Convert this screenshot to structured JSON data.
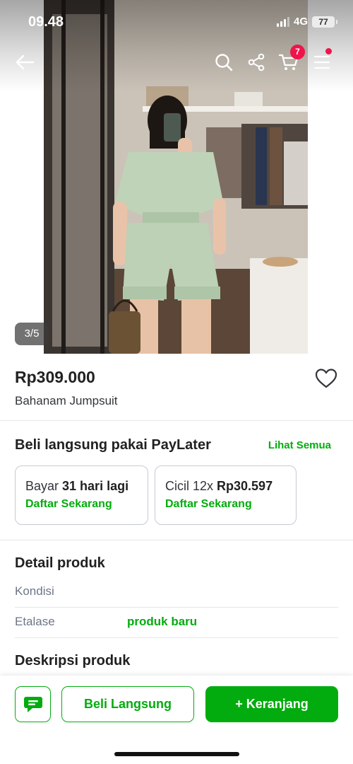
{
  "status_bar": {
    "time": "09.48",
    "network": "4G",
    "battery": "77"
  },
  "nav": {
    "cart_count": "7"
  },
  "gallery": {
    "counter": "3/5"
  },
  "product": {
    "price": "Rp309.000",
    "name": "Bahanam Jumpsuit"
  },
  "paylater": {
    "title": "Beli langsung pakai PayLater",
    "see_all": "Lihat Semua",
    "cards": [
      {
        "prefix": "Bayar ",
        "highlight": "31 hari lagi",
        "cta": "Daftar Sekarang"
      },
      {
        "prefix": "Cicil 12x ",
        "highlight": "Rp30.597",
        "cta": "Daftar Sekarang"
      }
    ]
  },
  "detail": {
    "title": "Detail produk",
    "rows": [
      {
        "label": "Kondisi",
        "value": ""
      },
      {
        "label": "Etalase",
        "value": "produk baru"
      }
    ]
  },
  "description": {
    "title": "Deskripsi produk"
  },
  "actions": {
    "buy_now": "Beli Langsung",
    "add_to_cart": "+ Keranjang"
  },
  "colors": {
    "primary_green": "#03ac0e",
    "badge_red": "#ef144a"
  }
}
